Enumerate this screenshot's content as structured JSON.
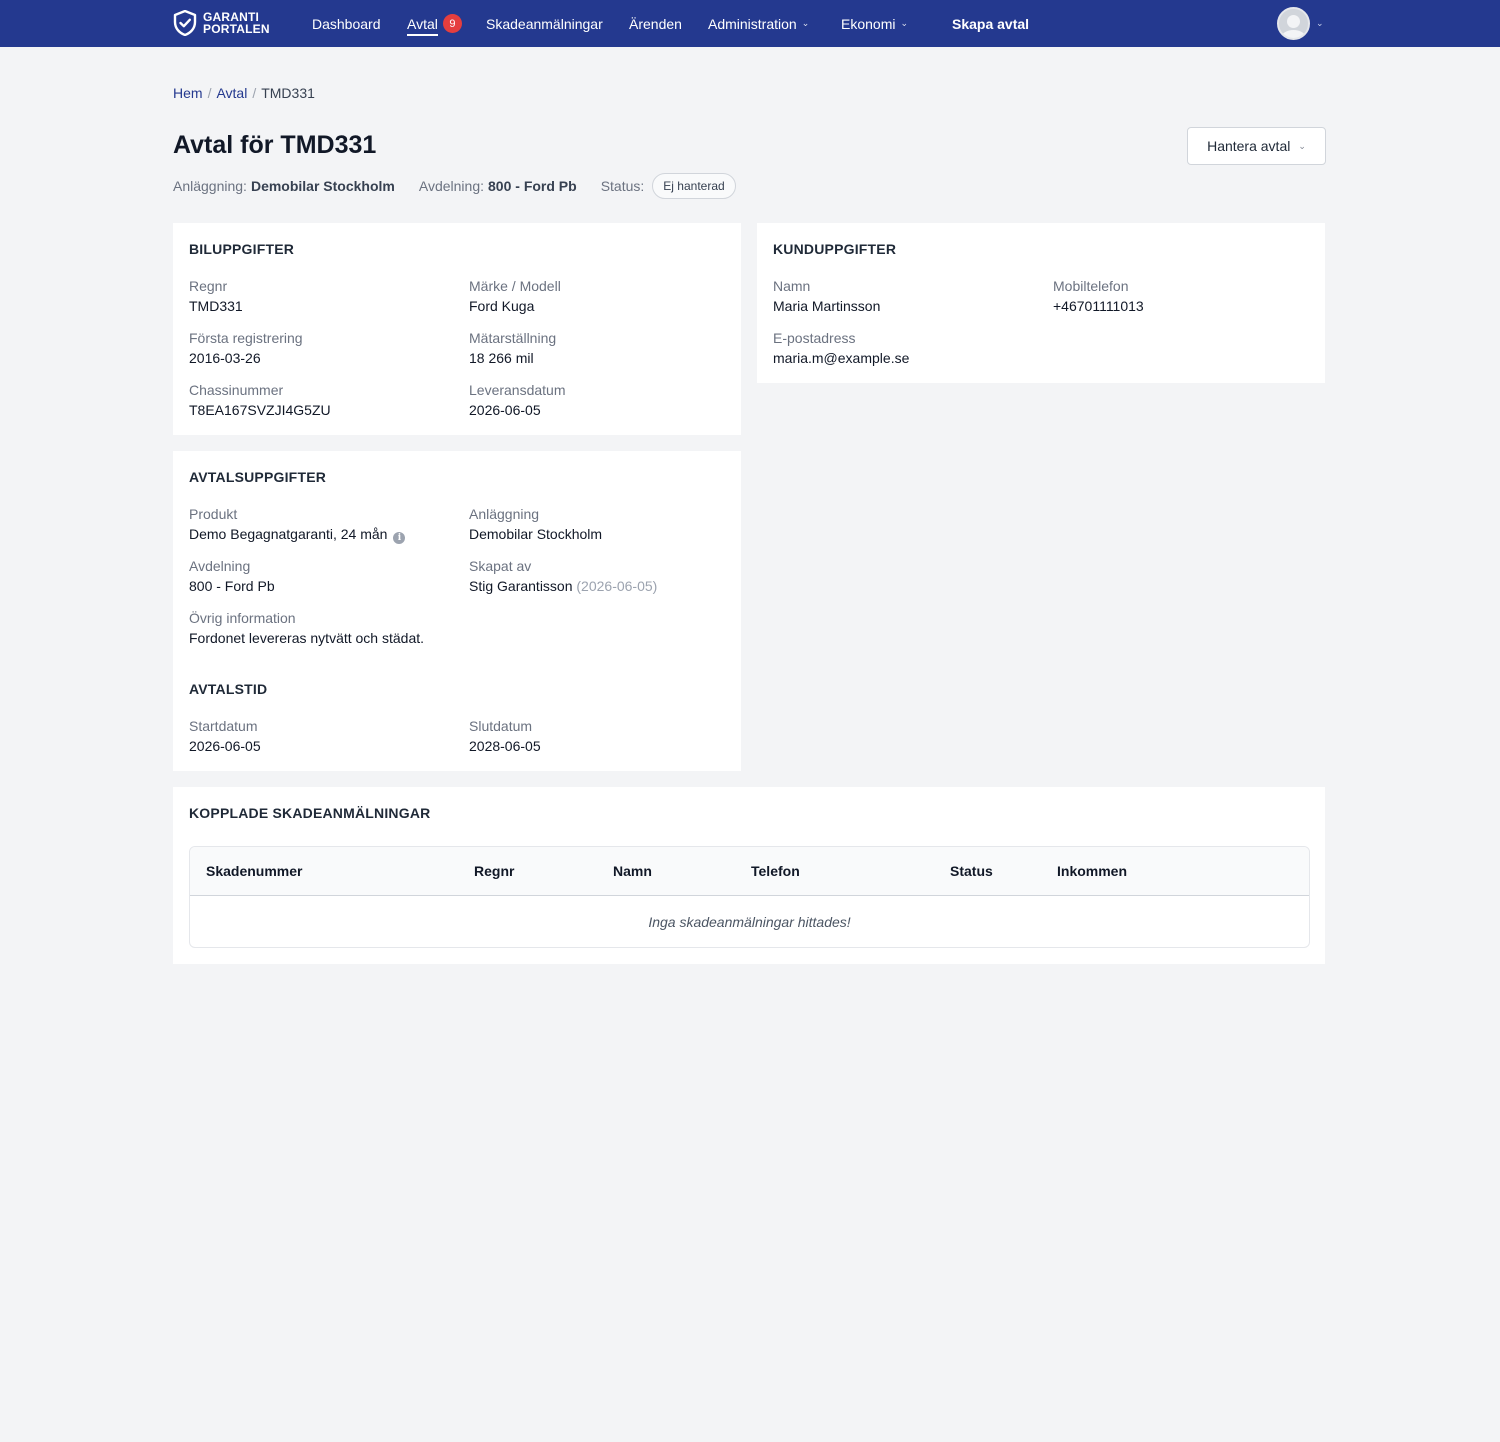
{
  "nav": {
    "logo_line1": "GARANTI",
    "logo_line2": "PORTALEN",
    "items": [
      {
        "label": "Dashboard"
      },
      {
        "label": "Avtal",
        "badge": "9"
      },
      {
        "label": "Skadeanmälningar"
      },
      {
        "label": "Ärenden"
      },
      {
        "label": "Administration"
      },
      {
        "label": "Ekonomi"
      }
    ],
    "cta": "Skapa avtal"
  },
  "breadcrumb": {
    "home": "Hem",
    "section": "Avtal",
    "current": "TMD331",
    "sep": "/"
  },
  "header": {
    "title": "Avtal för TMD331",
    "facility_label": "Anläggning:",
    "facility_value": "Demobilar Stockholm",
    "department_label": "Avdelning:",
    "department_value": "800 - Ford Pb",
    "status_label": "Status:",
    "status_value": "Ej hanterad",
    "manage_button": "Hantera avtal"
  },
  "car": {
    "title": "BILUPPGIFTER",
    "regnr_label": "Regnr",
    "regnr": "TMD331",
    "model_label": "Märke / Modell",
    "model": "Ford Kuga",
    "first_reg_label": "Första registrering",
    "first_reg": "2016-03-26",
    "mileage_label": "Mätarställning",
    "mileage": "18 266 mil",
    "vin_label": "Chassinummer",
    "vin": "T8EA167SVZJI4G5ZU",
    "delivery_label": "Leveransdatum",
    "delivery": "2026-06-05"
  },
  "customer": {
    "title": "KUNDUPPGIFTER",
    "name_label": "Namn",
    "name": "Maria Martinsson",
    "phone_label": "Mobiltelefon",
    "phone": "+46701111013",
    "email_label": "E-postadress",
    "email": "maria.m@example.se"
  },
  "contract": {
    "title": "AVTALSUPPGIFTER",
    "product_label": "Produkt",
    "product": "Demo Begagnatgaranti, 24 mån",
    "facility_label": "Anläggning",
    "facility": "Demobilar Stockholm",
    "department_label": "Avdelning",
    "department": "800 - Ford Pb",
    "created_by_label": "Skapat av",
    "created_by": "Stig Garantisson",
    "created_date": "(2026-06-05)",
    "other_label": "Övrig information",
    "other": "Fordonet levereras nytvätt och städat.",
    "period_title": "AVTALSTID",
    "start_label": "Startdatum",
    "start": "2026-06-05",
    "end_label": "Slutdatum",
    "end": "2028-06-05"
  },
  "claims": {
    "title": "KOPPLADE SKADEANMÄLNINGAR",
    "columns": [
      "Skadenummer",
      "Regnr",
      "Namn",
      "Telefon",
      "Status",
      "Inkommen"
    ],
    "empty": "Inga skadeanmälningar hittades!"
  }
}
